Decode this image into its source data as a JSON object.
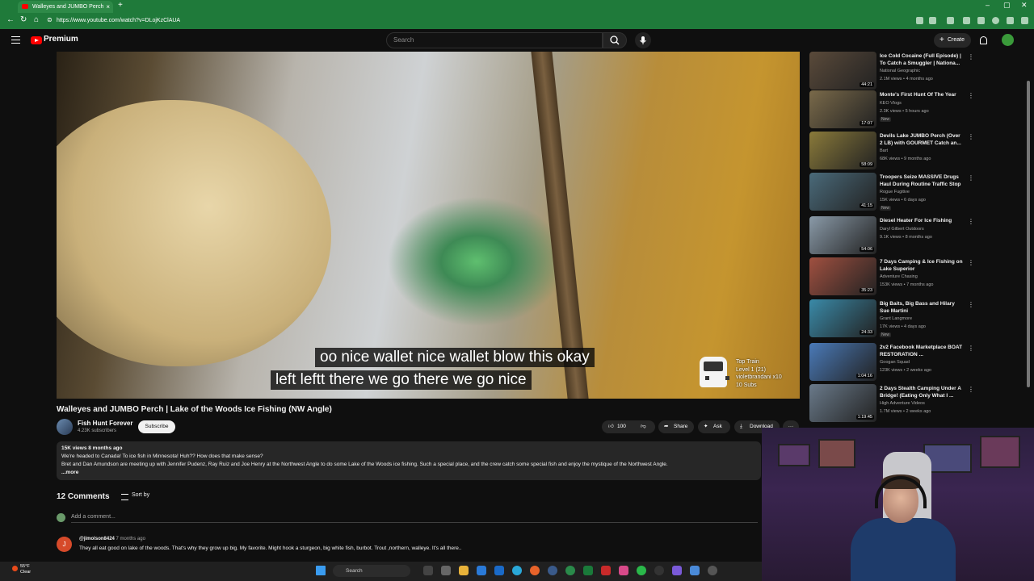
{
  "browser": {
    "tab_title": "Walleyes and JUMBO Perch",
    "url": "https://www.youtube.com/watch?v=DLojKzClAUA"
  },
  "header": {
    "brand": "Premium",
    "search_placeholder": "Search",
    "create_label": "Create"
  },
  "player": {
    "caption_line1": "oo nice wallet nice wallet blow this okay",
    "caption_line2": "left leftt there we go there we go nice",
    "alert": {
      "line1": "Top Train",
      "line2": "Level 1  (21)",
      "line3": "violetbrandani x10",
      "line4": "10 Subs"
    }
  },
  "video": {
    "title": "Walleyes and JUMBO Perch | Lake of the Woods Ice Fishing (NW Angle)",
    "channel": "Fish Hunt Forever",
    "subscribers": "4.23K subscribers",
    "subscribe_label": "Subscribe",
    "likes": "100",
    "share_label": "Share",
    "ask_label": "Ask",
    "download_label": "Download",
    "more_label": "···"
  },
  "description": {
    "stats": "15K views  8 months ago",
    "line1": "We're headed to Canada! To ice fish in Minnesota! Huh?? How does that make sense?",
    "line2": "Bret and Dan Amundson are meeting up with Jennifer Pudenz, Ray Ruiz and Joe Henry at the Northwest Angle to do some Lake of the Woods ice fishing. Such a special place, and the crew catch some special fish and enjoy the mystique of the Northwest Angle.",
    "more": "...more"
  },
  "comments": {
    "heading": "12 Comments",
    "sort_label": "Sort by",
    "add_placeholder": "Add a comment...",
    "items": [
      {
        "avatar_letter": "J",
        "user": "@jimolson8424",
        "time": "7 months ago",
        "text": "They all eat good on lake of the woods.  That's why they grow up big.  My favorite.  Might hook a  sturgeon,  big white fish, burbot.  Trout ,northern, walleye.  It's all there.."
      }
    ]
  },
  "sidebar": [
    {
      "title": "Ice Cold Cocaine (Full Episode) | To Catch a Smuggler | Nationa...",
      "channel": "National Geographic",
      "meta": "2.1M views • 4 months ago",
      "duration": "44:21",
      "badge": "",
      "color": "#5a4a3a"
    },
    {
      "title": "Monte's First Hunt Of The Year",
      "channel": "KEO Vlogs",
      "meta": "2.3K views • 5 hours ago",
      "duration": "17:07",
      "badge": "New",
      "color": "#7a6a4a"
    },
    {
      "title": "Devils Lake JUMBO Perch (Over 2 LB) with GOURMET Catch an...",
      "channel": "Bart",
      "meta": "68K views • 9 months ago",
      "duration": "58:09",
      "badge": "",
      "color": "#8a7a3a"
    },
    {
      "title": "Troopers Seize MASSIVE Drugs Haul During Routine Traffic Stop",
      "channel": "Rogue Fugitive",
      "meta": "15K views • 6 days ago",
      "duration": "41:15",
      "badge": "New",
      "color": "#4a6a7a"
    },
    {
      "title": "Diesel Heater For Ice Fishing",
      "channel": "Daryl Gilbert Outdoors",
      "meta": "9.1K views • 8 months ago",
      "duration": "54:06",
      "badge": "",
      "color": "#8a9aa8"
    },
    {
      "title": "7 Days Camping & Ice Fishing on Lake Superior",
      "channel": "Adventure Chasing",
      "meta": "153K views • 7 months ago",
      "duration": "35:23",
      "badge": "",
      "color": "#a05040"
    },
    {
      "title": "Big Baits, Big Bass and Hilary Sue Martini",
      "channel": "Grant Langmore",
      "meta": "17K views • 4 days ago",
      "duration": "24:33",
      "badge": "New",
      "color": "#3a8aa8"
    },
    {
      "title": "2v2 Facebook Marketplace BOAT RESTORATION ...",
      "channel": "Googan Squad",
      "meta": "123K views • 2 weeks ago",
      "duration": "1:04:16",
      "badge": "",
      "color": "#4a7ab8"
    },
    {
      "title": "2 Days Stealth Camping Under A Bridge! (Eating Only What I ...",
      "channel": "High Adventure Videos",
      "meta": "1.7M views • 2 weeks ago",
      "duration": "1:19:45",
      "badge": "",
      "color": "#6a7a8a"
    }
  ],
  "taskbar": {
    "temp": "55°F",
    "condition": "Clear",
    "search_label": "Search"
  },
  "colors": {
    "chrome_green": "#1f7a3a",
    "yt_red": "#ff0000",
    "background": "#0f0f0f"
  }
}
